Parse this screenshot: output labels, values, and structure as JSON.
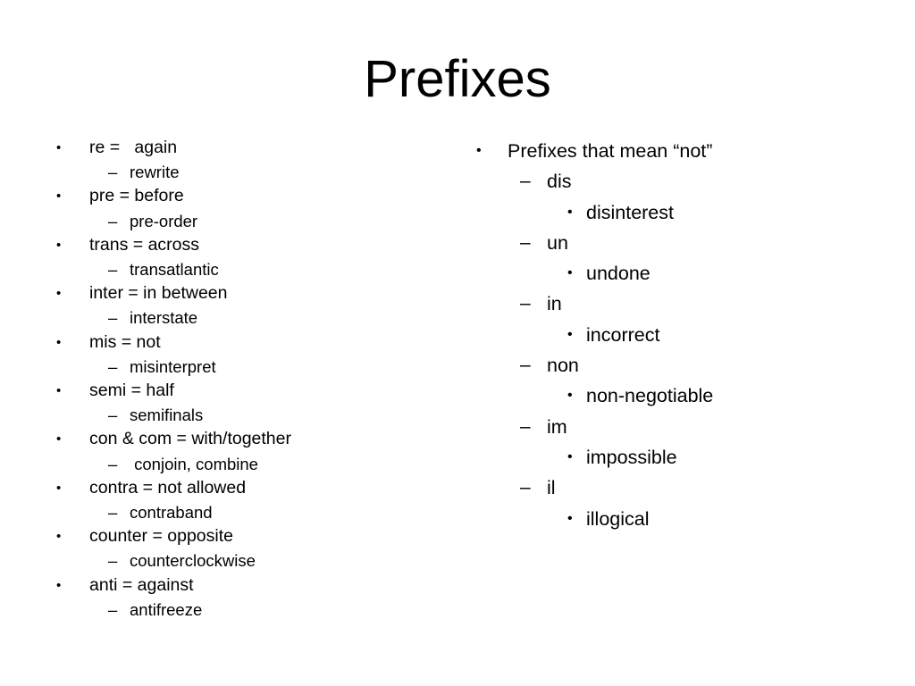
{
  "slide": {
    "title": "Prefixes",
    "background_color": "#ffffff",
    "text_color": "#000000"
  },
  "left_column": {
    "items": [
      {
        "prefix_line": "re =   again",
        "example_line": "rewrite"
      },
      {
        "prefix_line": "pre = before",
        "example_line": "pre-order"
      },
      {
        "prefix_line": "trans = across",
        "example_line": "transatlantic"
      },
      {
        "prefix_line": "inter = in between",
        "example_line": "interstate"
      },
      {
        "prefix_line": "mis = not",
        "example_line": "misinterpret"
      },
      {
        "prefix_line": "semi = half",
        "example_line": "semifinals"
      },
      {
        "prefix_line": "con & com = with/together",
        "example_line": " conjoin, combine"
      },
      {
        "prefix_line": "contra = not allowed",
        "example_line": "contraband"
      },
      {
        "prefix_line": "counter = opposite",
        "example_line": "counterclockwise"
      },
      {
        "prefix_line": "anti = against",
        "example_line": "antifreeze"
      }
    ]
  },
  "right_column": {
    "heading": "Prefixes that mean “not”",
    "items": [
      {
        "prefix": "dis",
        "example": "disinterest"
      },
      {
        "prefix": "un",
        "example": "undone"
      },
      {
        "prefix": "in",
        "example": "incorrect"
      },
      {
        "prefix": "non",
        "example": "non-negotiable"
      },
      {
        "prefix": "im",
        "example": "impossible"
      },
      {
        "prefix": "il",
        "example": "illogical"
      }
    ]
  },
  "markers": {
    "bullet": "•",
    "dash": "–"
  }
}
